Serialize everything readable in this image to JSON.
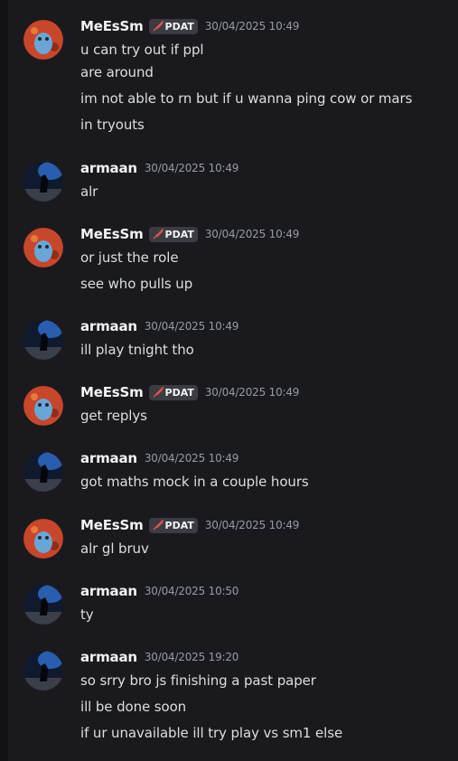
{
  "tag_label": "PDAT",
  "messages": [
    {
      "author": "MeEsSm",
      "time": "30/04/2025 10:49",
      "lines": [
        "u can try out if ppl",
        "are around",
        "im not able to rn but if u wanna ping cow or mars",
        "in tryouts"
      ]
    },
    {
      "author": "armaan",
      "time": "30/04/2025 10:49",
      "lines": [
        "alr"
      ]
    },
    {
      "author": "MeEsSm",
      "time": "30/04/2025 10:49",
      "lines": [
        "or just the role",
        "see who pulls up"
      ]
    },
    {
      "author": "armaan",
      "time": "30/04/2025 10:49",
      "lines": [
        "ill play tnight tho"
      ]
    },
    {
      "author": "MeEsSm",
      "time": "30/04/2025 10:49",
      "lines": [
        "get replys"
      ]
    },
    {
      "author": "armaan",
      "time": "30/04/2025 10:49",
      "lines": [
        "got maths mock in a couple hours"
      ]
    },
    {
      "author": "MeEsSm",
      "time": "30/04/2025 10:49",
      "lines": [
        "alr gl bruv"
      ]
    },
    {
      "author": "armaan",
      "time": "30/04/2025 10:50",
      "lines": [
        "ty"
      ]
    },
    {
      "author": "armaan",
      "time": "30/04/2025 19:20",
      "lines": [
        "so srry bro js finishing a past paper",
        "ill be done soon",
        "if ur unavailable ill try play vs sm1 else"
      ]
    }
  ]
}
